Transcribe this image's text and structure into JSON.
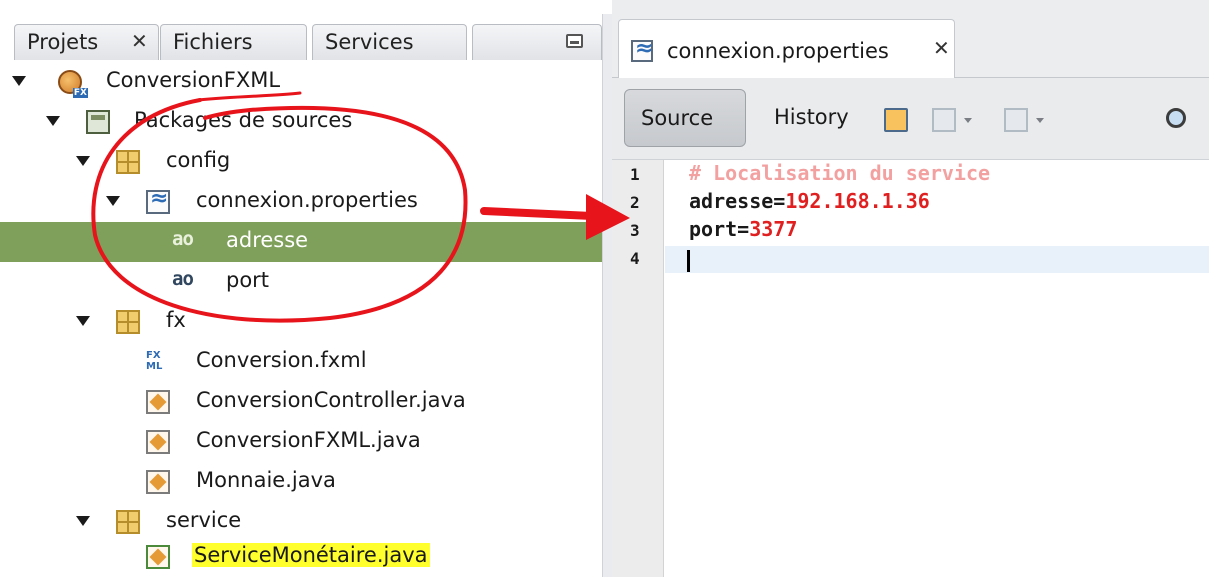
{
  "left_panel": {
    "tabs": [
      {
        "label": "Projets",
        "close": "✕"
      },
      {
        "label": "Fichiers"
      },
      {
        "label": "Services"
      }
    ],
    "tree": [
      {
        "label": "ConversionFXML",
        "icon": "project-icon"
      },
      {
        "label": "Packages de sources",
        "icon": "source-packages-icon"
      },
      {
        "label": "config",
        "icon": "package-icon"
      },
      {
        "label": "connexion.properties",
        "icon": "properties-file-icon"
      },
      {
        "label": "adresse",
        "icon": "property-key-icon",
        "icon_text": "ao",
        "selected": true
      },
      {
        "label": "port",
        "icon": "property-key-icon",
        "icon_text": "ao"
      },
      {
        "label": "fx",
        "icon": "package-icon"
      },
      {
        "label": "Conversion.fxml",
        "icon": "fxml-file-icon",
        "icon_text": "FX\nML"
      },
      {
        "label": "ConversionController.java",
        "icon": "java-file-icon"
      },
      {
        "label": "ConversionFXML.java",
        "icon": "java-file-icon"
      },
      {
        "label": "Monnaie.java",
        "icon": "java-file-icon"
      },
      {
        "label": "service",
        "icon": "package-icon"
      },
      {
        "label": "ServiceMonétaire.java",
        "icon": "java-main-file-icon",
        "highlighted": true
      }
    ]
  },
  "editor": {
    "tab_title": "connexion.properties",
    "tab_close": "✕",
    "toolbar": {
      "source_label": "Source",
      "history_label": "History"
    },
    "line_numbers": [
      "1",
      "2",
      "3",
      "4"
    ],
    "lines": [
      {
        "comment": "# Localisation du service"
      },
      {
        "key": "adresse",
        "sep": "=",
        "value": "192.168.1.36"
      },
      {
        "key": "port",
        "sep": "=",
        "value": "3377"
      },
      {
        "key": "",
        "sep": "",
        "value": ""
      }
    ]
  },
  "colors": {
    "selection": "#7ea05a",
    "highlight": "#ffff2e",
    "annotation_red": "#e8141c",
    "comment": "#f3a0a0",
    "value": "#e02020"
  }
}
